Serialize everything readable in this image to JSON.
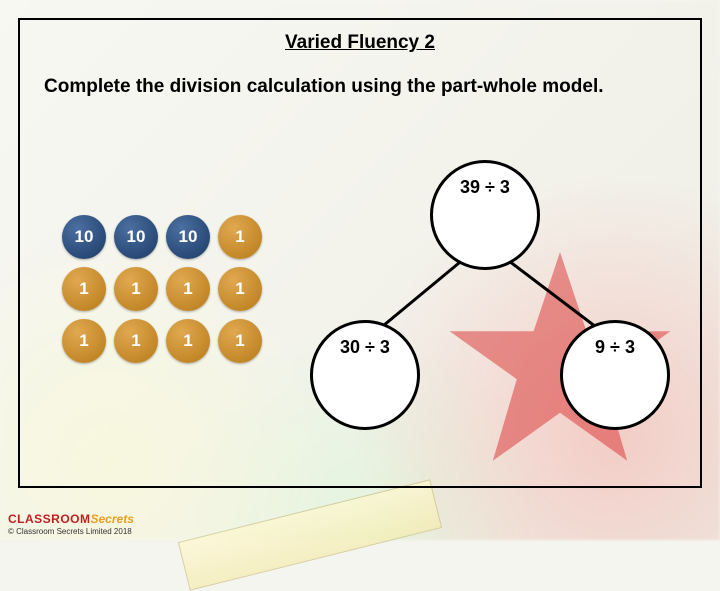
{
  "title": "Varied Fluency 2",
  "instruction": "Complete the division calculation using the part-whole model.",
  "counters": {
    "rows": [
      [
        "10",
        "10",
        "10",
        "1"
      ],
      [
        "1",
        "1",
        "1",
        "1"
      ],
      [
        "1",
        "1",
        "1",
        "1"
      ]
    ]
  },
  "partwhole": {
    "top": "39 ÷ 3",
    "left": "30 ÷ 3",
    "right": "9 ÷ 3"
  },
  "brand": {
    "line1a": "CLASSROOM",
    "line1b": "Secrets",
    "copyright": "© Classroom Secrets Limited 2018"
  }
}
